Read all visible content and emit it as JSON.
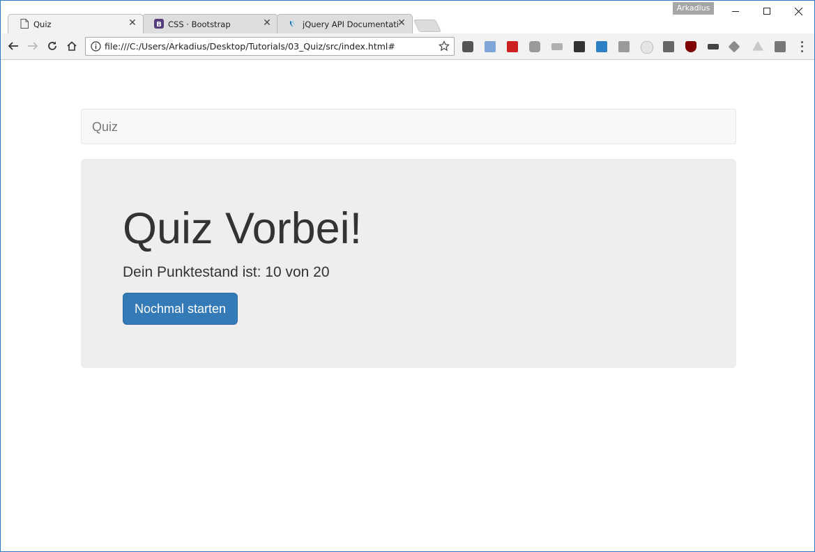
{
  "browser": {
    "profile_name": "Arkadius",
    "tabs": [
      {
        "label": "Quiz",
        "close": "✕"
      },
      {
        "label": "CSS · Bootstrap",
        "close": "✕"
      },
      {
        "label": "jQuery API Documentatio",
        "close": "✕"
      }
    ],
    "address_bar": {
      "url": "file:///C:/Users/Arkadius/Desktop/Tutorials/03_Quiz/src/index.html#"
    },
    "extension_icons": [
      "pocket-icon",
      "extension-icon",
      "lastpass-icon",
      "screenshot-icon",
      "wave-icon",
      "evernote-icon",
      "extension-icon",
      "extension-icon",
      "speech-bubble-icon",
      "jetbrains-icon",
      "ublock-icon",
      "extension-icon",
      "extension-icon",
      "drive-icon",
      "extension-icon"
    ],
    "colors": {
      "window_border": "#2b79c2",
      "tab_active": "#f2f2f2",
      "tab_inactive": "#dedede"
    }
  },
  "page": {
    "navbar": {
      "brand": "Quiz"
    },
    "jumbotron": {
      "title": "Quiz Vorbei!",
      "score_text": "Dein Punktestand ist: 10 von 20",
      "restart_button": "Nochmal starten"
    },
    "colors": {
      "primary": "#337ab7",
      "jumbotron_bg": "#eeeeee",
      "navbar_bg": "#f8f8f8"
    }
  }
}
